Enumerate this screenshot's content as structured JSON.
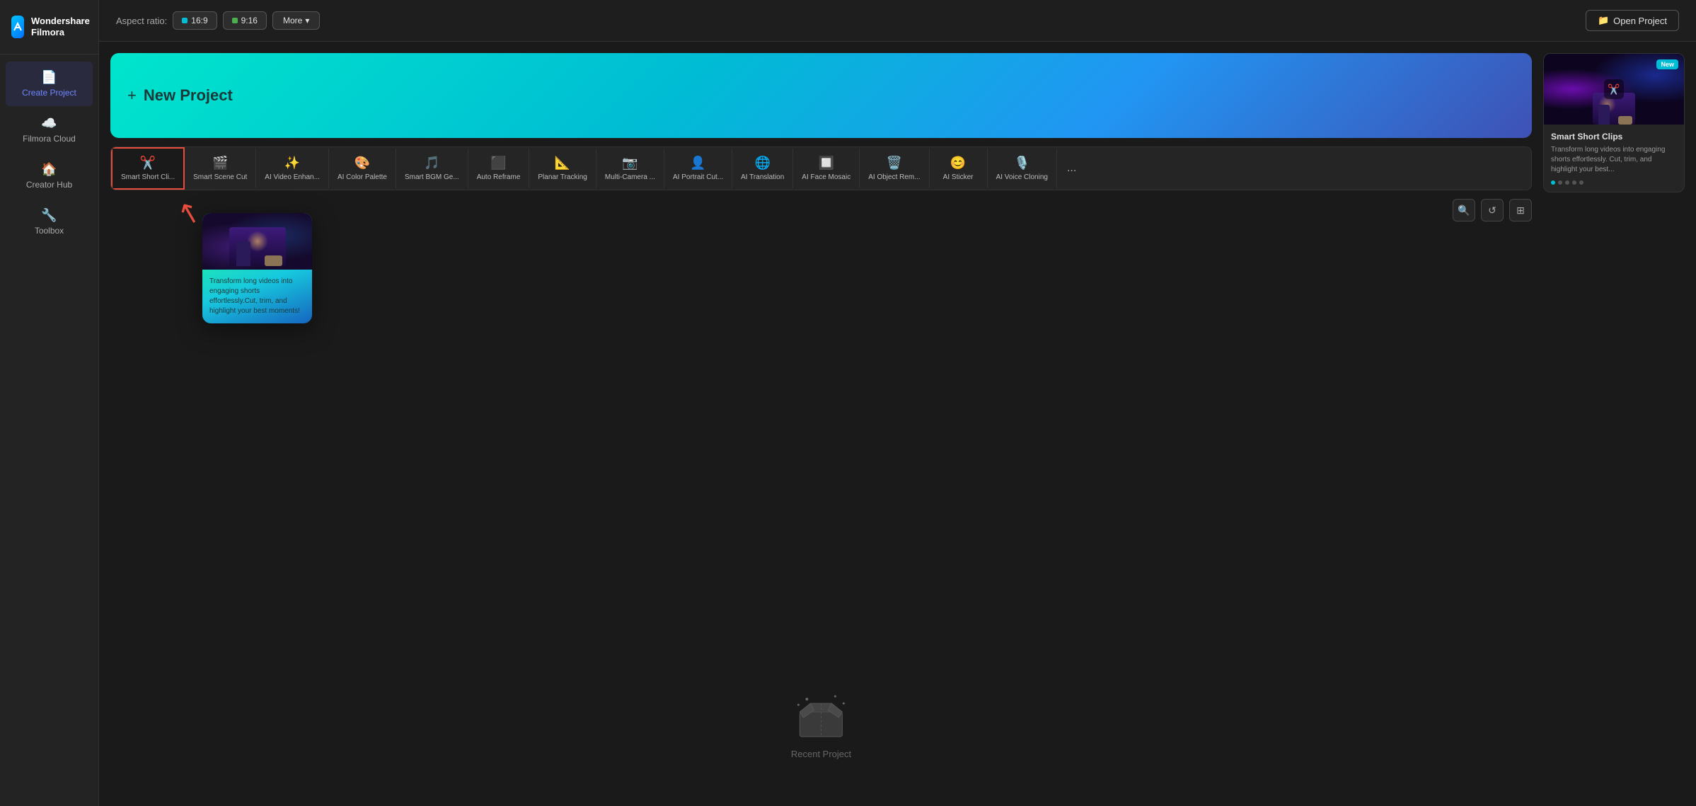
{
  "app": {
    "name": "Wondershare",
    "sub": "Filmora"
  },
  "sidebar": {
    "items": [
      {
        "id": "create-project",
        "label": "Create Project",
        "icon": "📄",
        "active": true
      },
      {
        "id": "filmora-cloud",
        "label": "Filmora Cloud",
        "icon": "☁️",
        "active": false
      },
      {
        "id": "creator-hub",
        "label": "Creator Hub",
        "icon": "🏠",
        "active": false
      },
      {
        "id": "toolbox",
        "label": "Toolbox",
        "icon": "🔧",
        "active": false
      }
    ]
  },
  "topbar": {
    "aspect_label": "Aspect ratio:",
    "ratios": [
      {
        "label": "16:9",
        "color": "#00bcd4"
      },
      {
        "label": "9:16",
        "color": "#4caf50"
      }
    ],
    "more_label": "More",
    "open_project_label": "Open Project"
  },
  "hero": {
    "title": "New Project",
    "plus_icon": "+"
  },
  "features": [
    {
      "id": "smart-short-clips",
      "label": "Smart Short Cli...",
      "icon": "✂️",
      "active": true
    },
    {
      "id": "smart-scene-cut",
      "label": "Smart Scene Cut",
      "icon": "🎬"
    },
    {
      "id": "ai-video-enhance",
      "label": "AI Video Enhan...",
      "icon": "✨"
    },
    {
      "id": "ai-color-palette",
      "label": "AI Color Palette",
      "icon": "🎨"
    },
    {
      "id": "smart-bgm-gen",
      "label": "Smart BGM Ge...",
      "icon": "🎵"
    },
    {
      "id": "auto-reframe",
      "label": "Auto Reframe",
      "icon": "⬛"
    },
    {
      "id": "planar-tracking",
      "label": "Planar Tracking",
      "icon": "📐"
    },
    {
      "id": "multi-camera",
      "label": "Multi-Camera ...",
      "icon": "📷"
    },
    {
      "id": "ai-portrait-cut",
      "label": "AI Portrait Cut...",
      "icon": "👤"
    },
    {
      "id": "ai-translation",
      "label": "AI Translation",
      "icon": "🌐"
    },
    {
      "id": "ai-face-mosaic",
      "label": "AI Face Mosaic",
      "icon": "🔲"
    },
    {
      "id": "ai-object-remove",
      "label": "AI Object Rem...",
      "icon": "🗑️"
    },
    {
      "id": "ai-sticker",
      "label": "AI Sticker",
      "icon": "😊"
    },
    {
      "id": "ai-voice-cloning",
      "label": "AI Voice Cloning",
      "icon": "🎙️"
    }
  ],
  "features_more": "...",
  "tooltip": {
    "description": "Transform long videos into engaging shorts effortlessly.Cut, trim, and highlight your best moments!"
  },
  "right_card": {
    "badge": "New",
    "title": "Smart Short Clips",
    "description": "Transform long videos into engaging shorts effortlessly. Cut, trim, and highlight your best...",
    "dots": [
      true,
      false,
      false,
      false,
      false
    ]
  },
  "file_area": {
    "search_icon": "🔍",
    "refresh_icon": "↺",
    "grid_icon": "⊞"
  },
  "recent": {
    "label": "Recent Project"
  }
}
